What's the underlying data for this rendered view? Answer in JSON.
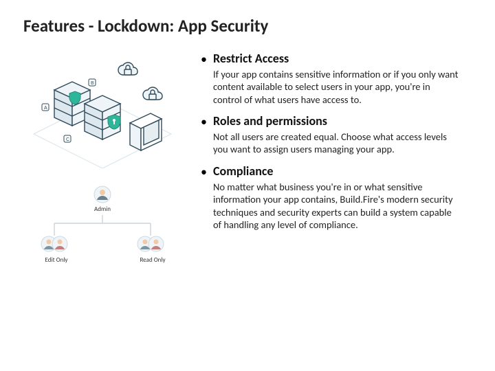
{
  "title": "Features - Lockdown: App Security",
  "features": [
    {
      "title": "Restrict Access",
      "body": "If your app contains sensitive information or if you only want content available to select users in your app, you're in control of what users have access to."
    },
    {
      "title": "Roles and permissions",
      "body": "Not all users are created equal. Choose what access levels you want to assign users managing your app."
    },
    {
      "title": "Compliance",
      "body": "No matter what business you're in or what sensitive information your app contains, Build.Fire's modern security techniques and security experts can build a system capable of handling any level of compliance."
    }
  ],
  "roles": {
    "admin": "Admin",
    "edit": "Edit Only",
    "read": "Read Only"
  },
  "icons": {
    "server": "server-icon",
    "shield": "shield-icon",
    "cloud": "cloud-icon",
    "lock": "lock-icon",
    "phone": "phone-icon",
    "avatar": "avatar-icon",
    "group": "group-icon"
  }
}
